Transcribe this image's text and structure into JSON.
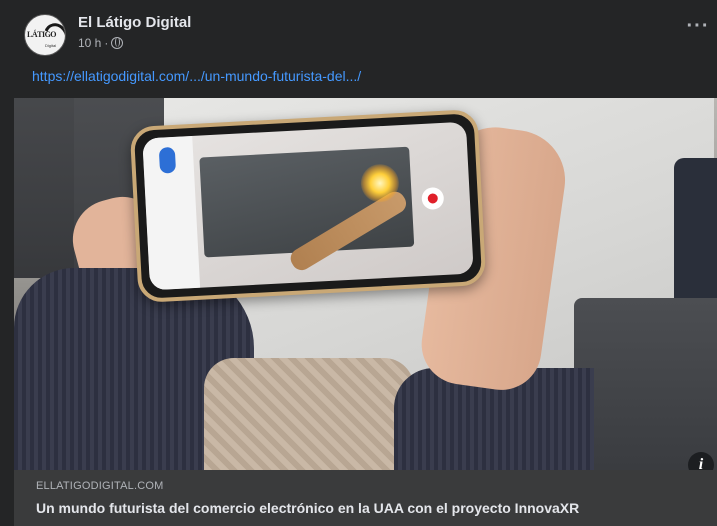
{
  "post": {
    "page_name": "El Látigo Digital",
    "time": "10 h",
    "separator": "·",
    "avatar_logo_text": "LÁTIGO",
    "avatar_logo_sub": "Digital",
    "more_label": "···",
    "link_text": "https://ellatigodigital.com/.../un-mundo-futurista-del.../"
  },
  "preview": {
    "info_label": "i",
    "domain": "ELLATIGODIGITAL.COM",
    "headline": "Un mundo futurista del comercio electrónico en la UAA con el proyecto InnovaXR"
  },
  "icons": {
    "privacy": "globe-icon",
    "more": "ellipsis-icon",
    "info": "info-icon"
  }
}
